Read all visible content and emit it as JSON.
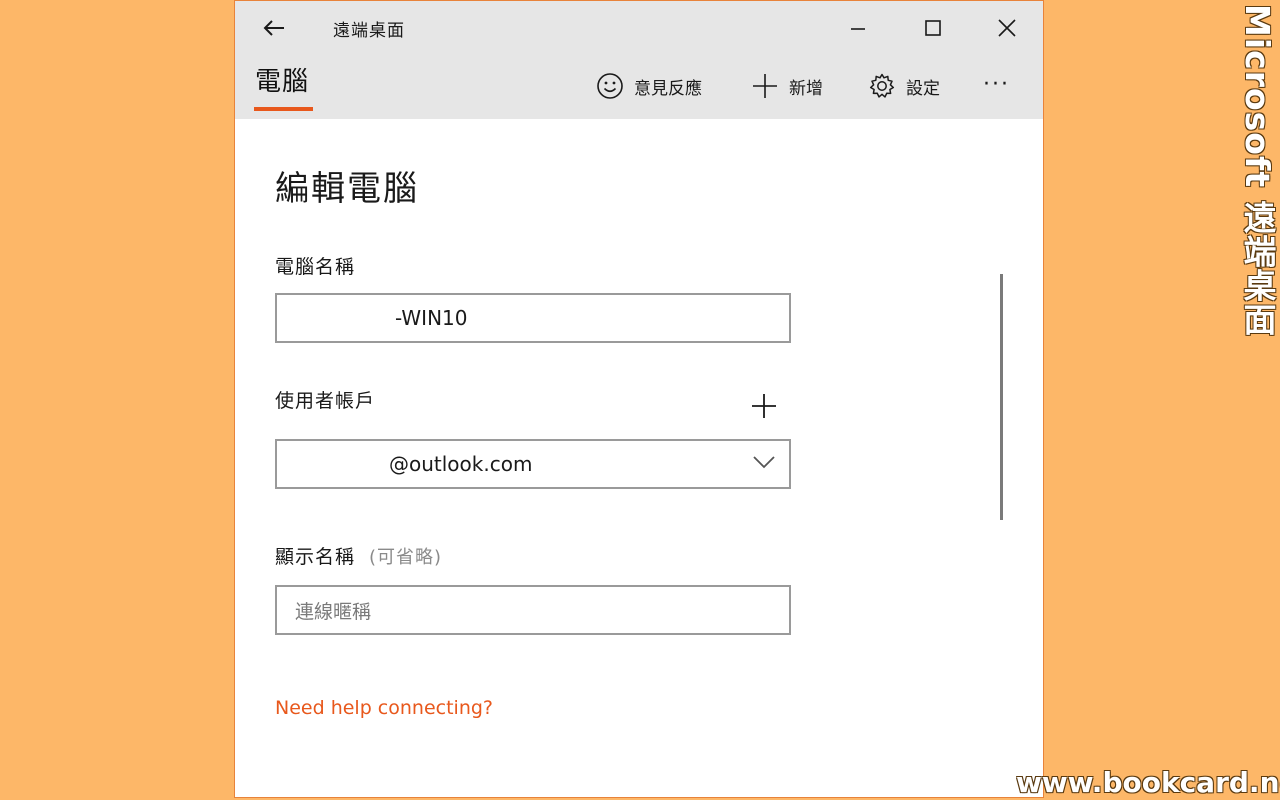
{
  "app": {
    "title": "遠端桌面"
  },
  "header": {
    "tab_label": "電腦",
    "toolbar": {
      "feedback_label": "意見反應",
      "add_label": "新增",
      "settings_label": "設定",
      "more_label": "···"
    }
  },
  "form": {
    "title": "編輯電腦",
    "pc_name": {
      "label": "電腦名稱",
      "value": "-WIN10"
    },
    "user_account": {
      "label": "使用者帳戶",
      "value": "@outlook.com"
    },
    "display_name": {
      "label": "顯示名稱",
      "optional_label": "(可省略)",
      "placeholder": "連線暱稱"
    },
    "help_link": "Need help connecting?"
  },
  "overlay": {
    "side_title": "Microsoft 遠端桌面",
    "watermark": "www.bookcard.net"
  },
  "colors": {
    "background": "#FDB768",
    "accent": "#E8581C",
    "titlebar": "#E6E6E6",
    "border": "#9A9A9A"
  },
  "icons": {
    "back": "back-arrow-icon",
    "minimize": "minimize-icon",
    "maximize": "maximize-icon",
    "close": "close-icon",
    "feedback": "smiley-icon",
    "add": "plus-icon",
    "settings": "gear-icon",
    "dropdown": "chevron-down-icon"
  }
}
